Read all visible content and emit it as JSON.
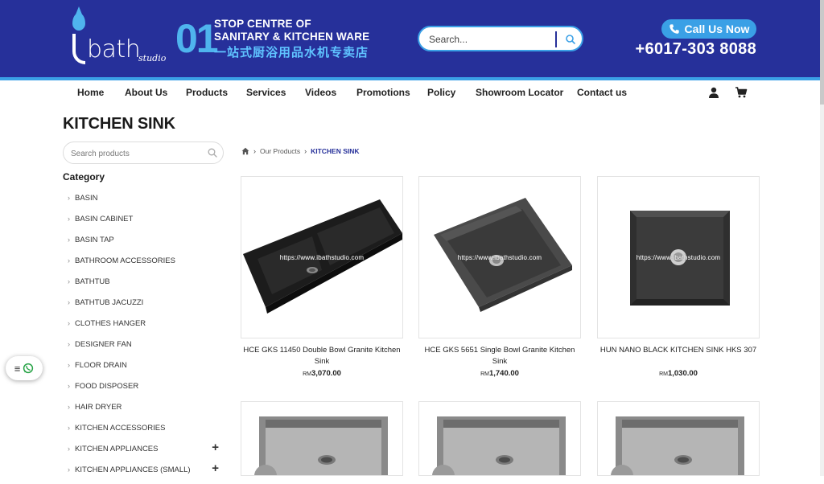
{
  "header": {
    "logo_text": "bath",
    "logo_subtext": "studio",
    "tag_number": "01",
    "tagline_line1": "STOP CENTRE OF",
    "tagline_line2": "SANITARY & KITCHEN WARE",
    "tagline_line3": "一站式厨浴用品水机专卖店",
    "search_placeholder": "Search...",
    "call_label": "Call Us Now",
    "phone": "+6017-303 8088",
    "brand_color": "#26309a",
    "accent_color": "#3aa0e6"
  },
  "nav": {
    "items": [
      "Home",
      "About Us",
      "Products",
      "Services",
      "Videos",
      "Promotions",
      "Policy",
      "Showroom Locator",
      "Contact us"
    ],
    "icons": [
      "user-icon",
      "cart-icon"
    ]
  },
  "sidebar": {
    "page_title": "KITCHEN SINK",
    "search_placeholder": "Search products",
    "category_title": "Category",
    "categories": [
      {
        "label": "BASIN",
        "expand": ""
      },
      {
        "label": "BASIN CABINET",
        "expand": ""
      },
      {
        "label": "BASIN TAP",
        "expand": ""
      },
      {
        "label": "BATHROOM ACCESSORIES",
        "expand": ""
      },
      {
        "label": "BATHTUB",
        "expand": ""
      },
      {
        "label": "BATHTUB JACUZZI",
        "expand": ""
      },
      {
        "label": "CLOTHES HANGER",
        "expand": ""
      },
      {
        "label": "DESIGNER FAN",
        "expand": ""
      },
      {
        "label": "FLOOR DRAIN",
        "expand": ""
      },
      {
        "label": "FOOD DISPOSER",
        "expand": ""
      },
      {
        "label": "HAIR DRYER",
        "expand": ""
      },
      {
        "label": "KITCHEN ACCESSORIES",
        "expand": ""
      },
      {
        "label": "KITCHEN APPLIANCES",
        "expand": "+"
      },
      {
        "label": "KITCHEN APPLIANCES (SMALL)",
        "expand": "+"
      }
    ]
  },
  "breadcrumb": {
    "home_icon": "home-icon",
    "level1": "Our Products",
    "current": "KITCHEN SINK"
  },
  "products": [
    {
      "name": "HCE GKS 11450 Double Bowl Granite Kitchen Sink",
      "currency": "RM",
      "price": "3,070.00",
      "watermark": "https://www.ibathstudio.com"
    },
    {
      "name": "HCE GKS 5651 Single Bowl Granite Kitchen Sink",
      "currency": "RM",
      "price": "1,740.00",
      "watermark": "https://www.ibathstudio.com"
    },
    {
      "name": "HUN NANO BLACK KITCHEN SINK HKS 307",
      "currency": "RM",
      "price": "1,030.00",
      "watermark": "https://www.ibathstudio.com"
    }
  ],
  "float_button": {
    "icons": [
      "menu-icon",
      "whatsapp-icon"
    ]
  }
}
